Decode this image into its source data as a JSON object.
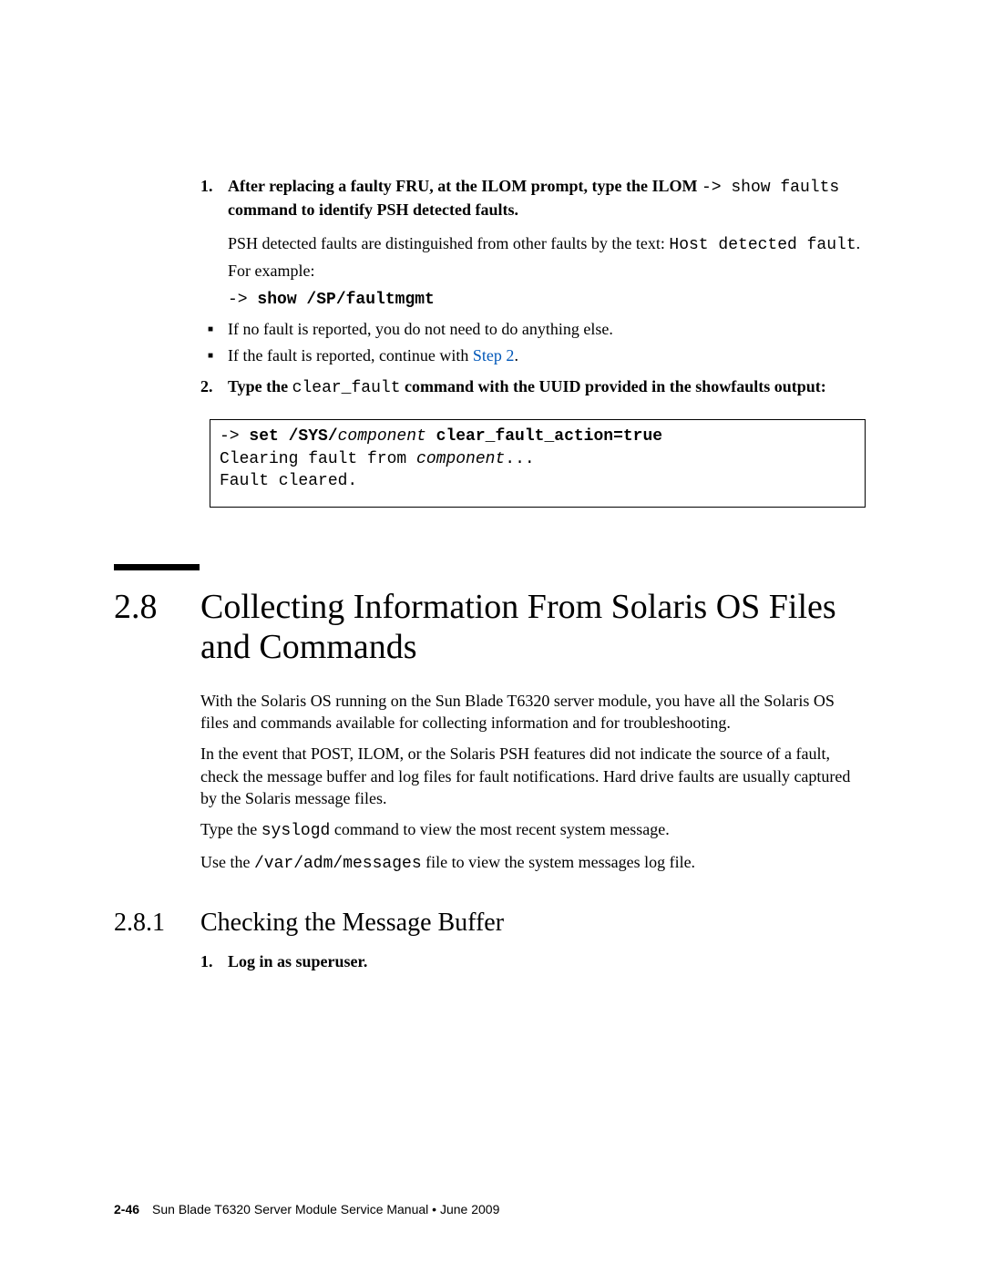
{
  "step1": {
    "num": "1.",
    "lead1": "After replacing a faulty FRU, at the ILOM prompt, type the ILOM ",
    "arrow": "->",
    "cmd": " show faults",
    "lead2": " command to identify PSH detected faults.",
    "body1": "PSH detected faults are distinguished from other faults by the text: ",
    "mono1": "Host detected fault",
    "dot1": ".",
    "body2": "For example:",
    "example_arrow": "->",
    "example_cmd": " show /SP/faultmgmt"
  },
  "bullet1": "If no fault is reported, you do not need to do anything else.",
  "bullet2_a": "If the fault is reported, continue with ",
  "bullet2_link": "Step 2",
  "bullet2_b": ".",
  "step2": {
    "num": "2.",
    "lead1": "Type the ",
    "cmd": "clear_fault",
    "lead2": " command with the UUID provided in the showfaults output:"
  },
  "codebox": {
    "arrow": "-> ",
    "set": "set /SYS/",
    "comp": "component",
    "action": " clear_fault_action=true",
    "line2a": "Clearing fault from ",
    "line2b": "component",
    "line2c": "...",
    "line3": "Fault cleared."
  },
  "section": {
    "num": "2.8",
    "title": "Collecting Information From Solaris OS Files and Commands",
    "p1": "With the Solaris OS running on the Sun Blade T6320 server module, you have all the Solaris OS files and commands available for collecting information and for troubleshooting.",
    "p2": "In the event that POST, ILOM, or the Solaris PSH features did not indicate the source of a fault, check the message buffer and log files for fault notifications. Hard drive faults are usually captured by the Solaris message files.",
    "p3_a": "Type the ",
    "p3_cmd": "syslogd",
    "p3_b": " command  to view the most recent system message.",
    "p4_a": "Use the ",
    "p4_cmd": "/var/adm/messages",
    "p4_b": " file to view the system messages log file."
  },
  "subsection": {
    "num": "2.8.1",
    "title": "Checking the Message Buffer",
    "step1_num": "1.",
    "step1_text": "Log in as superuser."
  },
  "footer": {
    "page": "2-46",
    "text": "Sun Blade T6320 Server Module Service Manual  •  June 2009"
  }
}
